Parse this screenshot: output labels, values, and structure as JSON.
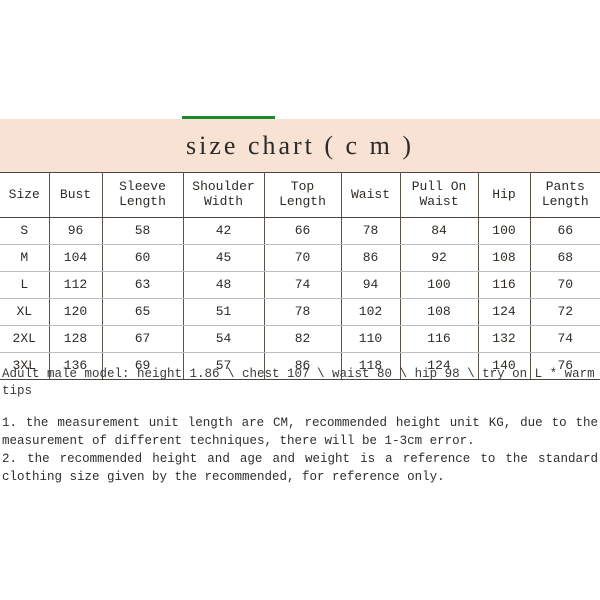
{
  "accent": {
    "color": "#1a8a2e"
  },
  "title": {
    "text": "size chart ( c m )",
    "band_color": "#f8e2d4"
  },
  "chart_data": {
    "type": "table",
    "title": "size chart ( c m )",
    "unit": "cm",
    "columns": [
      "Size",
      "Sleeve\nLength",
      "Shoulder\nWidth",
      "Top\nLength",
      "Waist",
      "Pull On\nWaist",
      "Hip",
      "Pants\nLength"
    ],
    "headers": [
      {
        "line1": "Size",
        "line2": ""
      },
      {
        "line1": "Bust",
        "line2": ""
      },
      {
        "line1": "Sleeve",
        "line2": "Length"
      },
      {
        "line1": "Shoulder",
        "line2": "Width"
      },
      {
        "line1": "Top",
        "line2": "Length"
      },
      {
        "line1": "Waist",
        "line2": ""
      },
      {
        "line1": "Pull On",
        "line2": "Waist"
      },
      {
        "line1": "Hip",
        "line2": ""
      },
      {
        "line1": "Pants",
        "line2": "Length"
      }
    ],
    "rows": [
      {
        "size": "S",
        "bust": "96",
        "sleeve_length": "58",
        "shoulder_width": "42",
        "top_length": "66",
        "waist": "78",
        "pull_on_waist": "84",
        "hip": "100",
        "pants_length": "66"
      },
      {
        "size": "M",
        "bust": "104",
        "sleeve_length": "60",
        "shoulder_width": "45",
        "top_length": "70",
        "waist": "86",
        "pull_on_waist": "92",
        "hip": "108",
        "pants_length": "68"
      },
      {
        "size": "L",
        "bust": "112",
        "sleeve_length": "63",
        "shoulder_width": "48",
        "top_length": "74",
        "waist": "94",
        "pull_on_waist": "100",
        "hip": "116",
        "pants_length": "70"
      },
      {
        "size": "XL",
        "bust": "120",
        "sleeve_length": "65",
        "shoulder_width": "51",
        "top_length": "78",
        "waist": "102",
        "pull_on_waist": "108",
        "hip": "124",
        "pants_length": "72"
      },
      {
        "size": "2XL",
        "bust": "128",
        "sleeve_length": "67",
        "shoulder_width": "54",
        "top_length": "82",
        "waist": "110",
        "pull_on_waist": "116",
        "hip": "132",
        "pants_length": "74"
      },
      {
        "size": "3XL",
        "bust": "136",
        "sleeve_length": "69",
        "shoulder_width": "57",
        "top_length": "86",
        "waist": "118",
        "pull_on_waist": "124",
        "hip": "140",
        "pants_length": "76"
      }
    ]
  },
  "notes": {
    "model": "Adult male model: height 1.86 \\ chest 107 \\ waist 80 \\ hip 98 \\ try on L * warm tips",
    "item1": "1. the measurement unit length are CM, recommended height unit KG, due to the measurement of different techniques, there will be 1-3cm error.",
    "item2": "2. the recommended height and age and weight is a reference to the standard clothing size given by the recommended, for reference only."
  }
}
